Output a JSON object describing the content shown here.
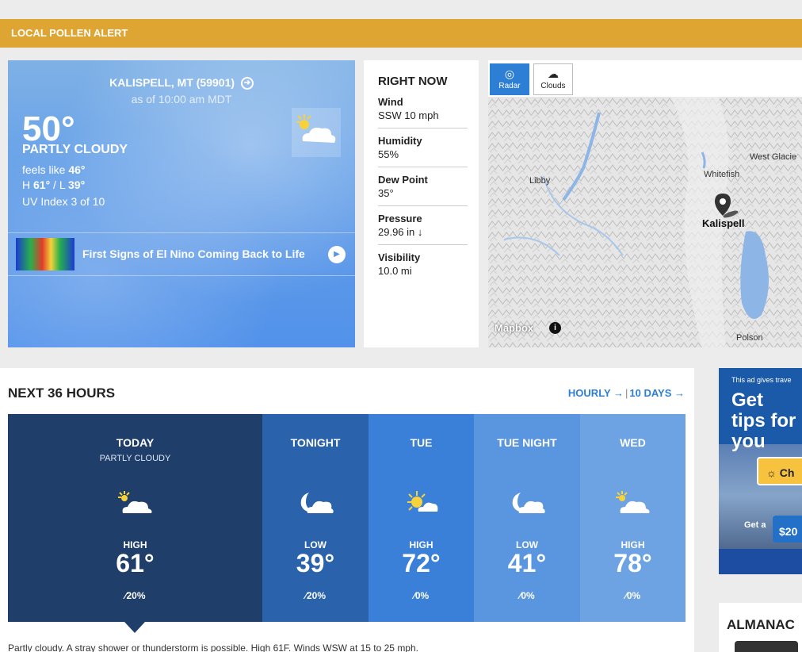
{
  "alert": {
    "label": "LOCAL POLLEN ALERT"
  },
  "current": {
    "location": "KALISPELL, MT (59901)",
    "as_of": "as of 10:00 am MDT",
    "temp": "50°",
    "phrase": "PARTLY CLOUDY",
    "feels_prefix": "feels like ",
    "feels_value": "46°",
    "high_prefix": "H ",
    "high_value": "61°",
    "low_sep": " / L ",
    "low_value": "39°",
    "uv": "UV Index 3 of 10",
    "icon": "partly-cloudy-icon",
    "video_title": "First Signs of El Nino Coming Back to Life"
  },
  "right_now": {
    "title": "RIGHT NOW",
    "items": [
      {
        "label": "Wind",
        "value": "SSW 10 mph"
      },
      {
        "label": "Humidity",
        "value": "55%"
      },
      {
        "label": "Dew Point",
        "value": "35°"
      },
      {
        "label": "Pressure",
        "value": "29.96 in ↓"
      },
      {
        "label": "Visibility",
        "value": "10.0 mi"
      }
    ]
  },
  "map": {
    "buttons": [
      {
        "label": "Radar",
        "icon": "radar-icon",
        "active": true
      },
      {
        "label": "Clouds",
        "icon": "clouds-icon",
        "active": false
      }
    ],
    "labels": {
      "libby": "Libby",
      "whitefish": "Whitefish",
      "west_glacier": "West Glacie",
      "kalispell": "Kalispell",
      "polson": "Polson"
    },
    "attribution": "Mapbox",
    "info": "i"
  },
  "forecast": {
    "title": "NEXT 36 HOURS",
    "hourly_link": "HOURLY →",
    "tendays_link": "10 DAYS →",
    "periods": [
      {
        "name": "TODAY",
        "phrase": "PARTLY CLOUDY",
        "icon": "partly-cloudy-icon",
        "temp_label": "HIGH",
        "temp": "61°",
        "precip": "20%",
        "color": "#1f3e6a"
      },
      {
        "name": "TONIGHT",
        "phrase": "",
        "icon": "partly-cloudy-night-icon",
        "temp_label": "LOW",
        "temp": "39°",
        "precip": "20%",
        "color": "#2a62ac"
      },
      {
        "name": "TUE",
        "phrase": "",
        "icon": "sunny-icon",
        "temp_label": "HIGH",
        "temp": "72°",
        "precip": "0%",
        "color": "#3a7fd8"
      },
      {
        "name": "TUE NIGHT",
        "phrase": "",
        "icon": "partly-cloudy-night-icon",
        "temp_label": "LOW",
        "temp": "41°",
        "precip": "0%",
        "color": "#5a96e0"
      },
      {
        "name": "WED",
        "phrase": "",
        "icon": "partly-cloudy-icon",
        "temp_label": "HIGH",
        "temp": "78°",
        "precip": "0%",
        "color": "#6da3e3"
      }
    ],
    "narrative": "Partly cloudy. A stray shower or thunderstorm is possible. High 61F. Winds WSW at 15 to 25 mph."
  },
  "ad": {
    "small": "This ad gives trave",
    "headline": "Get tips for you",
    "cta": "Ch",
    "get": "Get a",
    "amount": "$20"
  },
  "almanac": {
    "title": "ALMANAC"
  }
}
